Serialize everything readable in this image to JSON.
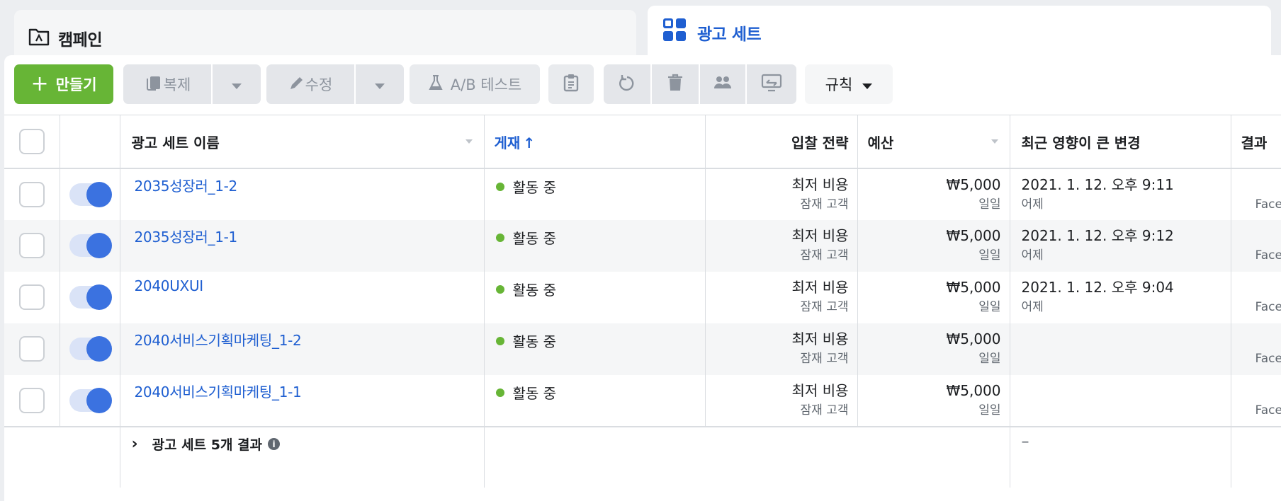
{
  "tabs": {
    "campaign": "캠페인",
    "adset": "광고 세트"
  },
  "toolbar": {
    "create": "만들기",
    "duplicate": "복제",
    "edit": "수정",
    "ab_test": "A/B 테스트",
    "rules": "규칙"
  },
  "table": {
    "headers": {
      "name": "광고 세트 이름",
      "delivery": "게재",
      "bid_strategy": "입찰 전략",
      "budget": "예산",
      "recent_change": "최근 영향이 큰 변경",
      "results": "결과"
    },
    "rows": [
      {
        "name": "2035성장러_1-2",
        "status": "활동 중",
        "bid": "최저 비용",
        "bid_sub": "잠재 고객",
        "budget": "₩5,000",
        "budget_sub": "일일",
        "change": "2021. 1. 12. 오후 9:11",
        "change_sub": "어제",
        "results_sub": "Face"
      },
      {
        "name": "2035성장러_1-1",
        "status": "활동 중",
        "bid": "최저 비용",
        "bid_sub": "잠재 고객",
        "budget": "₩5,000",
        "budget_sub": "일일",
        "change": "2021. 1. 12. 오후 9:12",
        "change_sub": "어제",
        "results_sub": "Face"
      },
      {
        "name": "2040UXUI",
        "status": "활동 중",
        "bid": "최저 비용",
        "bid_sub": "잠재 고객",
        "budget": "₩5,000",
        "budget_sub": "일일",
        "change": "2021. 1. 12. 오후 9:04",
        "change_sub": "어제",
        "results_sub": "Face"
      },
      {
        "name": "2040서비스기획마케팅_1-2",
        "status": "활동 중",
        "bid": "최저 비용",
        "bid_sub": "잠재 고객",
        "budget": "₩5,000",
        "budget_sub": "일일",
        "change": "",
        "change_sub": "",
        "results_sub": "Face"
      },
      {
        "name": "2040서비스기획마케팅_1-1",
        "status": "활동 중",
        "bid": "최저 비용",
        "bid_sub": "잠재 고객",
        "budget": "₩5,000",
        "budget_sub": "일일",
        "change": "",
        "change_sub": "",
        "results_sub": "Face"
      }
    ],
    "summary": {
      "label": "광고 세트 5개 결과",
      "change": "–"
    }
  },
  "colors": {
    "primary": "#1f5fd1",
    "create_green": "#67b536",
    "toggle_on": "#3b72e0",
    "active_dot": "#67b536"
  }
}
